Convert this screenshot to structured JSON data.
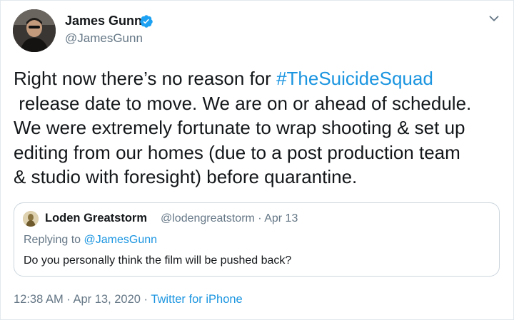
{
  "author": {
    "name": "James Gunn",
    "handle": "@JamesGunn"
  },
  "tweet": {
    "lines": [
      {
        "pre": "Right now there’s no reason for ",
        "hashtag": "#TheSuicideSquad"
      },
      {
        "text": " release date to move. We are on or ahead of schedule."
      },
      {
        "text": "We were extremely fortunate to wrap shooting & set up"
      },
      {
        "text": "editing from our homes (due to a post production team"
      },
      {
        "text": "& studio with foresight) before quarantine."
      }
    ]
  },
  "quote": {
    "name": "Loden Greatstorm",
    "handle_date": "@lodengreatstorm · Apr 13",
    "replying_prefix": "Replying to ",
    "replying_to": "@JamesGunn",
    "text": "Do you personally think the film will be pushed back?"
  },
  "footer": {
    "time_date": "12:38 AM · Apr 13, 2020 · ",
    "source": "Twitter for iPhone"
  },
  "colors": {
    "link": "#1b95e0",
    "secondary_text": "#657786",
    "border": "#ccd6dd",
    "verified": "#1da1f2"
  },
  "icons": {
    "verified": "verified-badge-icon",
    "more": "chevron-down-icon"
  }
}
